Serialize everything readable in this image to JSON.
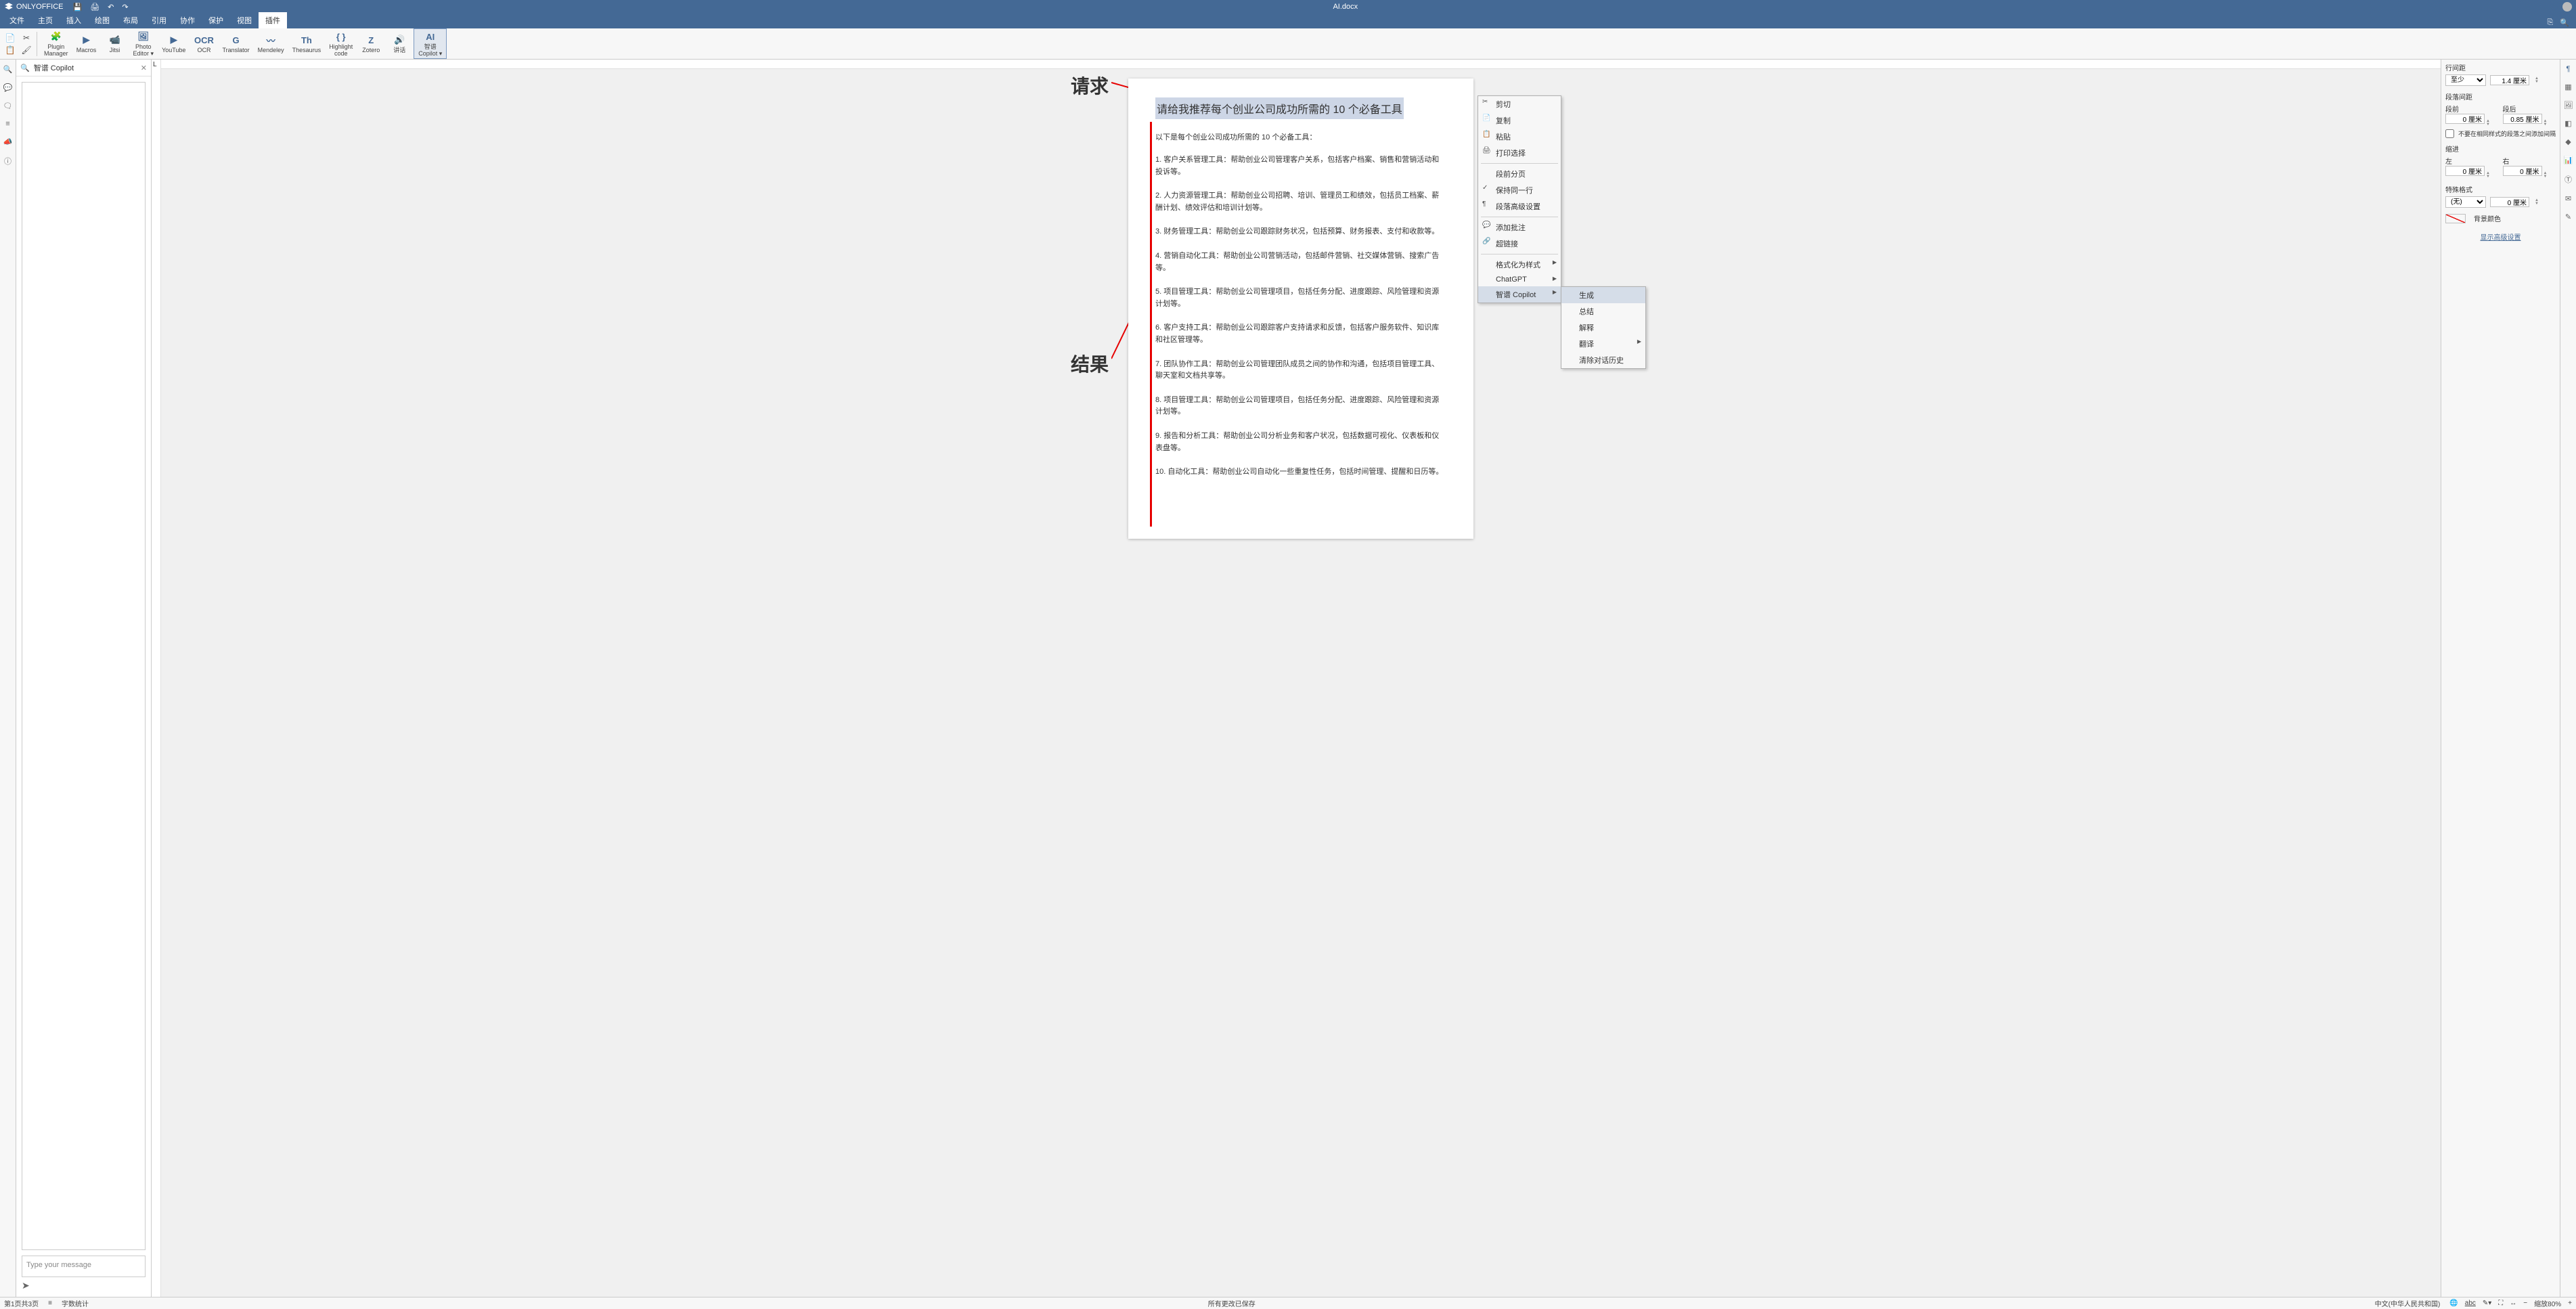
{
  "app": {
    "name": "ONLYOFFICE",
    "doc_title": "AI.docx"
  },
  "qat": {
    "save": "💾",
    "print": "🖨",
    "undo": "↶",
    "redo": "↷"
  },
  "menu_tabs": [
    "文件",
    "主页",
    "插入",
    "绘图",
    "布局",
    "引用",
    "协作",
    "保护",
    "视图",
    "插件"
  ],
  "menu_active_index": 9,
  "ribbon": [
    {
      "label": "Plugin\nManager",
      "icon_name": "plugin-manager-icon"
    },
    {
      "label": "Macros",
      "icon_name": "macros-icon"
    },
    {
      "label": "Jitsi",
      "icon_name": "jitsi-icon"
    },
    {
      "label": "Photo\nEditor",
      "icon_name": "photo-editor-icon",
      "dropdown": true
    },
    {
      "label": "YouTube",
      "icon_name": "youtube-icon"
    },
    {
      "label": "OCR",
      "icon_name": "ocr-icon"
    },
    {
      "label": "Translator",
      "icon_name": "translator-icon"
    },
    {
      "label": "Mendeley",
      "icon_name": "mendeley-icon"
    },
    {
      "label": "Thesaurus",
      "icon_name": "thesaurus-icon"
    },
    {
      "label": "Highlight\ncode",
      "icon_name": "highlight-code-icon"
    },
    {
      "label": "Zotero",
      "icon_name": "zotero-icon"
    },
    {
      "label": "讲话",
      "icon_name": "speak-icon"
    },
    {
      "label": "智谱\nCopilot",
      "icon_name": "ai-copilot-icon",
      "active": true,
      "dropdown": true
    }
  ],
  "copilot": {
    "title": "智谱 Copilot",
    "placeholder": "Type your message"
  },
  "document": {
    "prompt": "请给我推荐每个创业公司成功所需的 10 个必备工具",
    "intro": "以下是每个创业公司成功所需的 10 个必备工具：",
    "items": [
      "1. 客户关系管理工具：帮助创业公司管理客户关系，包括客户档案、销售和营销活动和投诉等。",
      "2. 人力资源管理工具：帮助创业公司招聘、培训、管理员工和绩效，包括员工档案、薪酬计划、绩效评估和培训计划等。",
      "3. 财务管理工具：帮助创业公司跟踪财务状况，包括预算、财务报表、支付和收款等。",
      "4. 营销自动化工具：帮助创业公司营销活动，包括邮件营销、社交媒体营销、搜索广告等。",
      "5. 项目管理工具：帮助创业公司管理项目，包括任务分配、进度跟踪、风险管理和资源计划等。",
      "6. 客户支持工具：帮助创业公司跟踪客户支持请求和反馈，包括客户服务软件、知识库和社区管理等。",
      "7. 团队协作工具：帮助创业公司管理团队成员之间的协作和沟通，包括项目管理工具、聊天室和文档共享等。",
      "8. 项目管理工具：帮助创业公司管理项目，包括任务分配、进度跟踪、风险管理和资源计划等。",
      "9. 报告和分析工具：帮助创业公司分析业务和客户状况，包括数据可视化、仪表板和仪表盘等。",
      "10. 自动化工具：帮助创业公司自动化一些重复性任务，包括时间管理、提醒和日历等。"
    ]
  },
  "annotations": {
    "request": "请求",
    "result": "结果"
  },
  "context_menu": {
    "items": [
      {
        "label": "剪切",
        "icon": "✂"
      },
      {
        "label": "复制",
        "icon": "📄"
      },
      {
        "label": "粘贴",
        "icon": "📋"
      },
      {
        "label": "打印选择",
        "icon": "🖨"
      },
      {
        "sep": true
      },
      {
        "label": "段前分页"
      },
      {
        "label": "保持同一行",
        "icon": "✓"
      },
      {
        "label": "段落高级设置",
        "icon": "¶"
      },
      {
        "sep": true
      },
      {
        "label": "添加批注",
        "icon": "💬"
      },
      {
        "label": "超链接",
        "icon": "🔗"
      },
      {
        "sep": true
      },
      {
        "label": "格式化为样式",
        "arrow": true
      },
      {
        "label": "ChatGPT",
        "arrow": true
      },
      {
        "label": "智谱 Copilot",
        "arrow": true,
        "hovered": true
      }
    ],
    "submenu": [
      {
        "label": "生成",
        "hovered": true
      },
      {
        "label": "总结"
      },
      {
        "label": "解释"
      },
      {
        "label": "翻译",
        "arrow": true
      },
      {
        "label": "清除对话历史"
      }
    ]
  },
  "para_panel": {
    "line_spacing_label": "行间距",
    "line_spacing_type": "至少",
    "line_spacing_value": "1.4 厘米",
    "para_spacing_label": "段落间距",
    "before_label": "段前",
    "before_value": "0 厘米",
    "after_label": "段后",
    "after_value": "0.85 厘米",
    "no_space_label": "不要在相同样式的段落之间添加间隔",
    "indent_label": "缩进",
    "left_label": "左",
    "left_value": "0 厘米",
    "right_label": "右",
    "right_value": "0 厘米",
    "special_label": "特殊格式",
    "special_type": "(无)",
    "special_value": "0 厘米",
    "bg_color_label": "背景颜色",
    "advanced_link": "显示高级设置"
  },
  "status": {
    "pages": "第1页共3页",
    "word_count": "字数统计",
    "saved": "所有更改已保存",
    "language": "中文(中华人民共和国)",
    "zoom": "缩放80%"
  }
}
